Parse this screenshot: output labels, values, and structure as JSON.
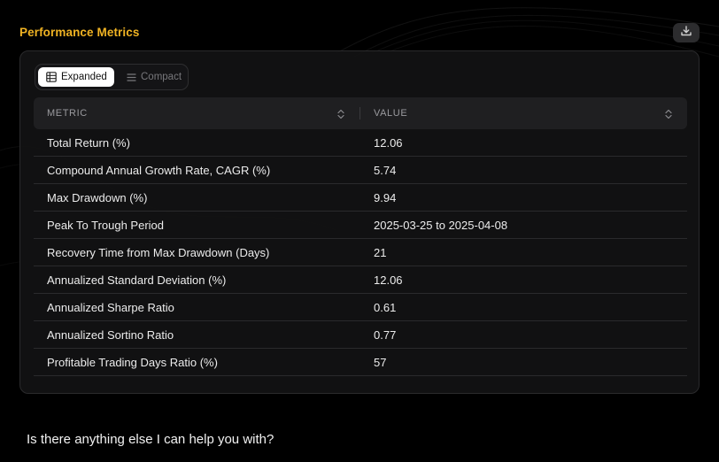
{
  "section": {
    "title": "Performance Metrics"
  },
  "toolbar": {
    "download_icon": "download-icon"
  },
  "view_toggle": {
    "options": [
      {
        "label": "Expanded",
        "icon": "table-icon",
        "active": true
      },
      {
        "label": "Compact",
        "icon": "list-icon",
        "active": false
      }
    ]
  },
  "table": {
    "columns": [
      {
        "label": "METRIC",
        "sort_icon": "sort-icon"
      },
      {
        "label": "VALUE",
        "sort_icon": "sort-icon"
      }
    ],
    "rows": [
      {
        "metric": "Total Return (%)",
        "value": "12.06"
      },
      {
        "metric": "Compound Annual Growth Rate, CAGR (%)",
        "value": "5.74"
      },
      {
        "metric": "Max Drawdown (%)",
        "value": "9.94"
      },
      {
        "metric": "Peak To Trough Period",
        "value": "2025-03-25 to 2025-04-08"
      },
      {
        "metric": "Recovery Time from Max Drawdown (Days)",
        "value": "21"
      },
      {
        "metric": "Annualized Standard Deviation (%)",
        "value": "12.06"
      },
      {
        "metric": "Annualized Sharpe Ratio",
        "value": "0.61"
      },
      {
        "metric": "Annualized Sortino Ratio",
        "value": "0.77"
      },
      {
        "metric": "Profitable Trading Days Ratio (%)",
        "value": "57"
      }
    ]
  },
  "chat": {
    "followup": "Is there anything else I can help you with?"
  },
  "colors": {
    "accent": "#f0b323",
    "background": "#000000",
    "card": "#121214",
    "header_row": "#1f1f21"
  }
}
